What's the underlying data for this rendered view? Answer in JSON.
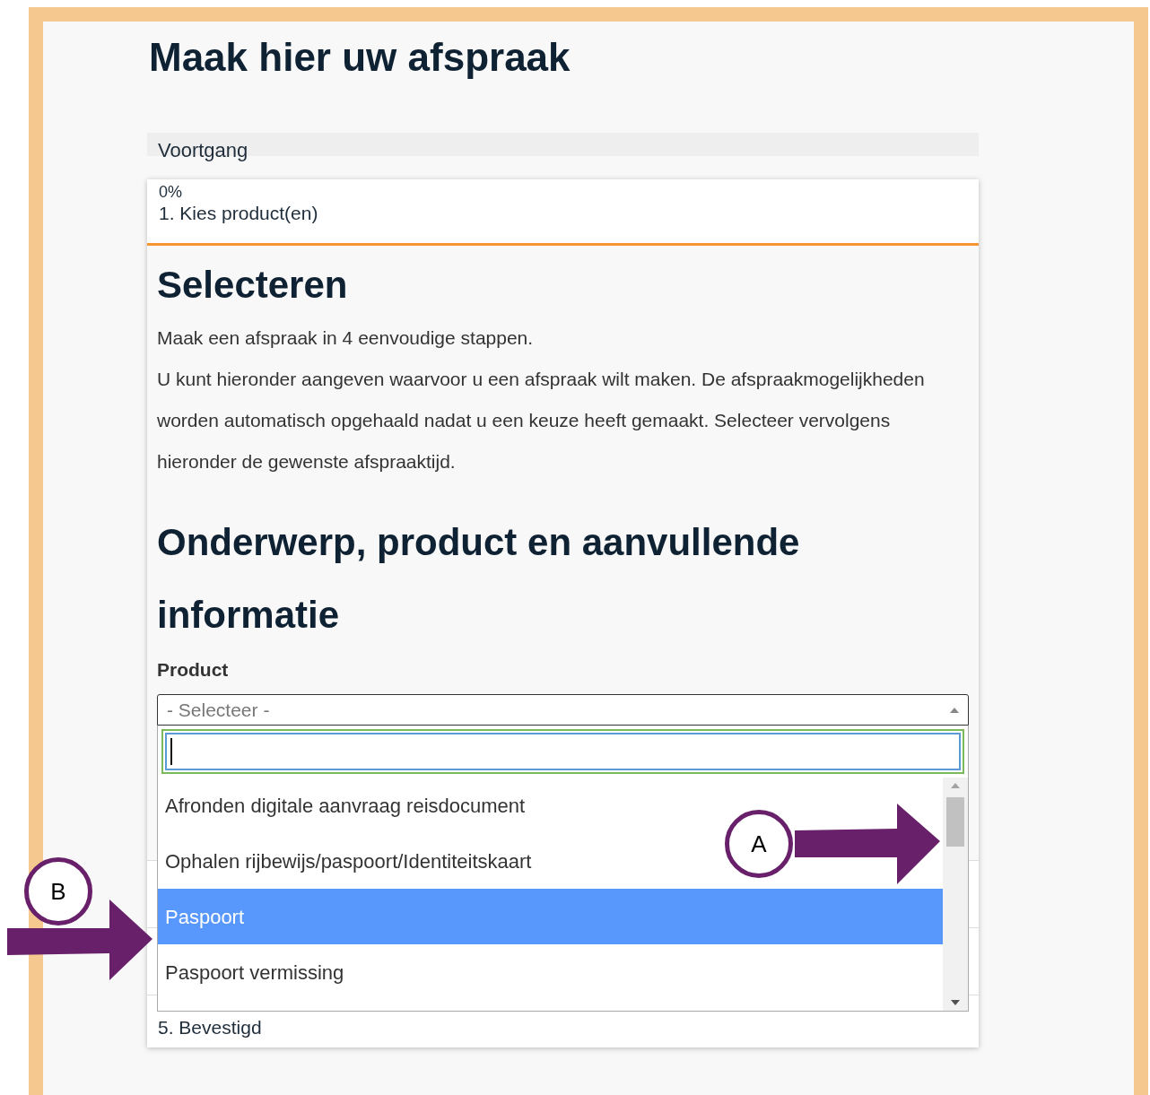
{
  "page_title": "Maak hier uw afspraak",
  "progress": {
    "label": "Voortgang",
    "reading": "0%",
    "level": 0
  },
  "current_step": {
    "label": "1. Kies product(en)"
  },
  "section": {
    "heading": "Selecteren",
    "paragraphs": [
      "Maak een afspraak in 4 eenvoudige stappen.",
      "U kunt hieronder aangeven waarvoor u een afspraak wilt maken. De afspraakmogelijkheden worden automatisch opgehaald nadat u een keuze heeft gemaakt. Selecteer vervolgens hieronder de gewenste afspraaktijd."
    ],
    "subheading": "Onderwerp, product en aanvullende informatie"
  },
  "product_field": {
    "label": "Product",
    "placeholder": "- Selecteer -",
    "expanded": true,
    "options": [
      {
        "label": "Afronden digitale aanvraag reisdocument",
        "selected": false
      },
      {
        "label": "Ophalen rijbewijs/paspoort/Identiteitskaart",
        "selected": false
      },
      {
        "label": "Paspoort",
        "selected": true
      },
      {
        "label": "Paspoort vermissing",
        "selected": false
      }
    ]
  },
  "last_step": {
    "label": "5. Bevestigd"
  },
  "annotations": [
    {
      "label": "A"
    },
    {
      "label": "B"
    }
  ]
}
